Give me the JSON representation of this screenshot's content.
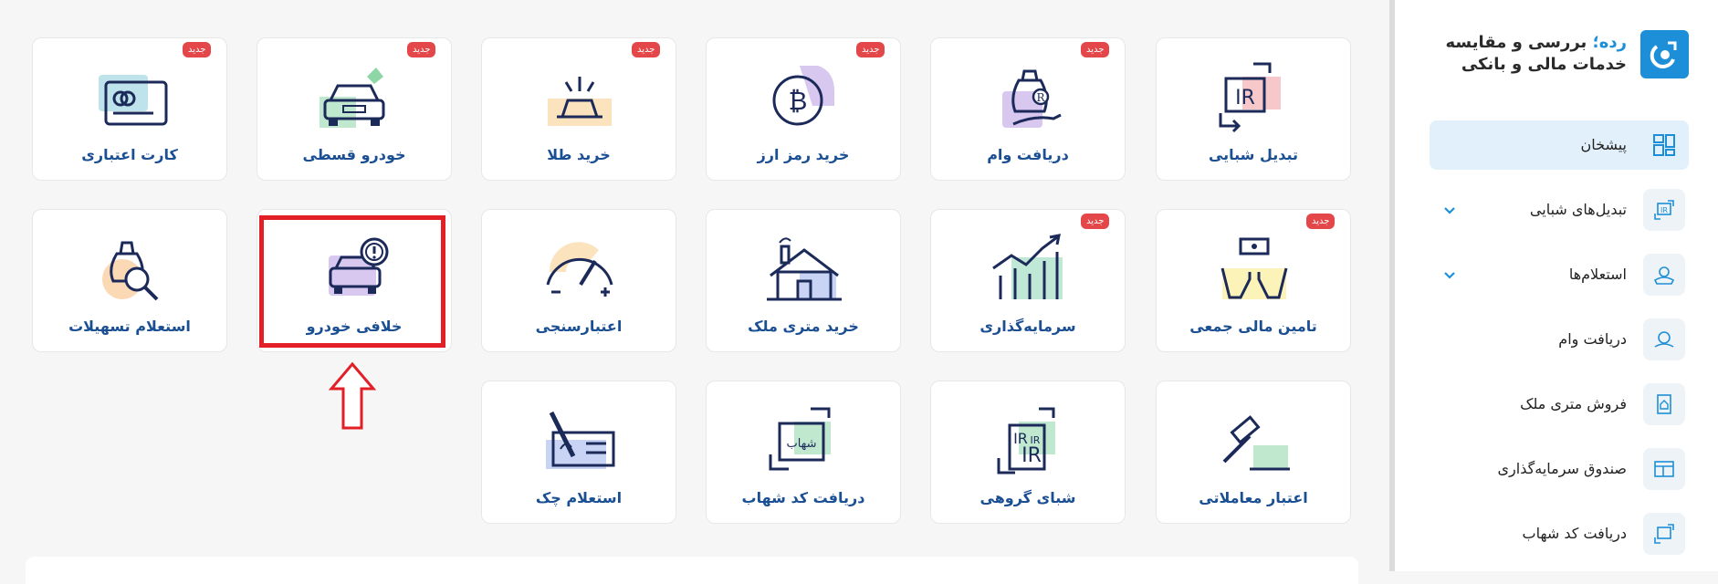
{
  "brand": {
    "name_accent": "رده؛",
    "name_line1_rest": " بررسی و مقایسه",
    "name_line2": "خدمات مالی و بانکی"
  },
  "sidebar": {
    "items": [
      {
        "label": "پیشخان",
        "icon": "dashboard-icon",
        "active": true
      },
      {
        "label": "تبدیل‌های شبایی",
        "icon": "iban-convert-icon",
        "expandable": true
      },
      {
        "label": "استعلام‌ها",
        "icon": "inquiry-icon",
        "expandable": true
      },
      {
        "label": "دریافت وام",
        "icon": "loan-icon"
      },
      {
        "label": "فروش متری ملک",
        "icon": "property-sale-icon"
      },
      {
        "label": "صندوق سرمایه‌گذاری",
        "icon": "investment-fund-icon"
      },
      {
        "label": "دریافت کد شهاب",
        "icon": "shahab-code-icon"
      }
    ]
  },
  "badge_text": "جدید",
  "cards": [
    {
      "label": "تبدیل شبایی",
      "icon": "iban-convert-icon",
      "is_new": false
    },
    {
      "label": "دریافت وام",
      "icon": "loan-bag-icon",
      "is_new": true
    },
    {
      "label": "خرید رمز ارز",
      "icon": "bitcoin-icon",
      "is_new": true
    },
    {
      "label": "خرید طلا",
      "icon": "gold-bar-icon",
      "is_new": true
    },
    {
      "label": "خودرو قسطی",
      "icon": "car-installment-icon",
      "is_new": true
    },
    {
      "label": "کارت اعتباری",
      "icon": "credit-card-icon",
      "is_new": true
    },
    {
      "label": "تامین مالی جمعی",
      "icon": "crowdfunding-icon",
      "is_new": true
    },
    {
      "label": "سرمایه‌گذاری",
      "icon": "investment-chart-icon",
      "is_new": true
    },
    {
      "label": "خرید متری ملک",
      "icon": "house-icon",
      "is_new": false
    },
    {
      "label": "اعتبارسنجی",
      "icon": "credit-gauge-icon",
      "is_new": false
    },
    {
      "label": "خلافی خودرو",
      "icon": "car-violation-icon",
      "is_new": false,
      "highlighted": true
    },
    {
      "label": "استعلام تسهیلات",
      "icon": "loan-inquiry-icon",
      "is_new": false
    },
    {
      "label": "اعتبار معاملاتی",
      "icon": "gavel-icon",
      "is_new": false
    },
    {
      "label": "شبای گروهی",
      "icon": "group-iban-icon",
      "is_new": false
    },
    {
      "label": "دریافت کد شهاب",
      "icon": "shahab-code-icon",
      "is_new": false
    },
    {
      "label": "استعلام چک",
      "icon": "cheque-icon",
      "is_new": false
    }
  ],
  "colors": {
    "accent": "#1d8fd8",
    "label": "#1b4f93",
    "badge": "#e4474a",
    "highlight": "#e21e26",
    "sidebar_active": "#e1f0fa"
  }
}
